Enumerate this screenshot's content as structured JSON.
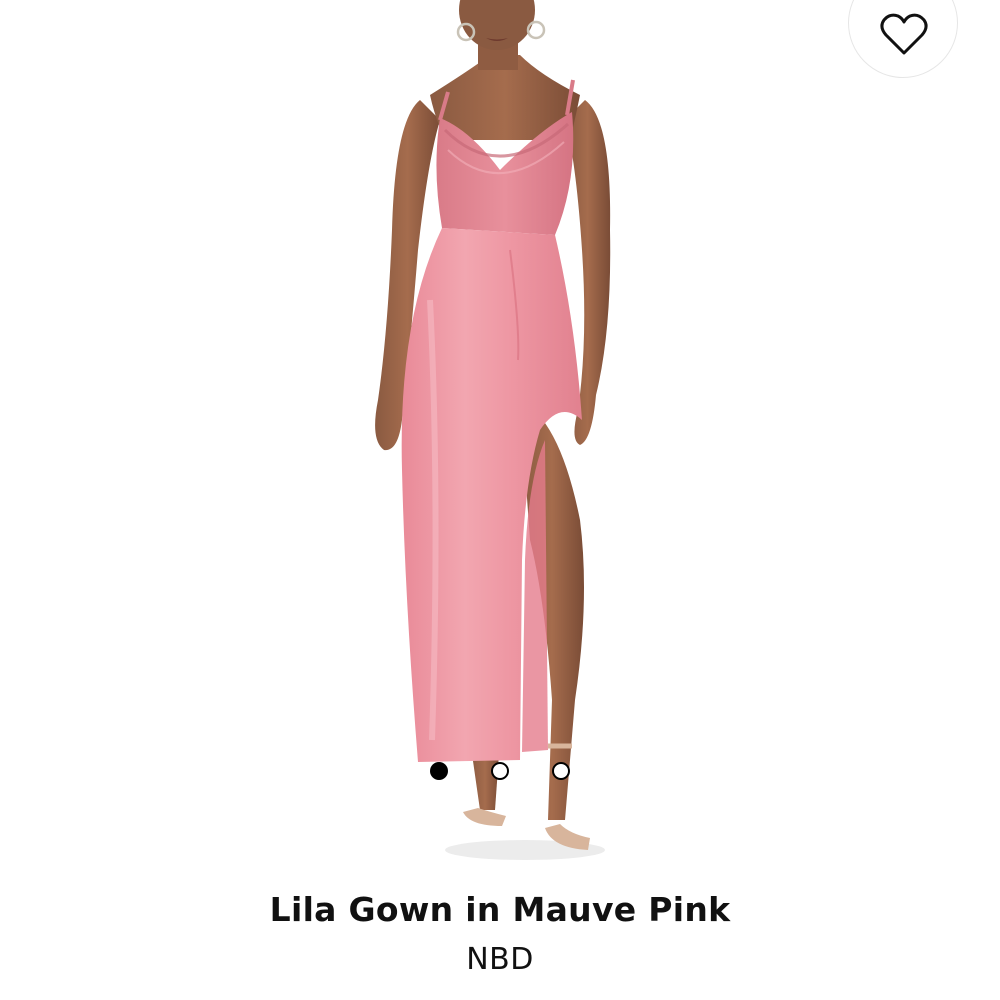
{
  "product": {
    "title": "Lila Gown in Mauve Pink",
    "brand": "NBD",
    "dress_color": "#ea8f9c"
  },
  "wishlist": {
    "icon": "heart-outline-icon"
  },
  "carousel": {
    "total_images": 3,
    "active_index": 0
  }
}
